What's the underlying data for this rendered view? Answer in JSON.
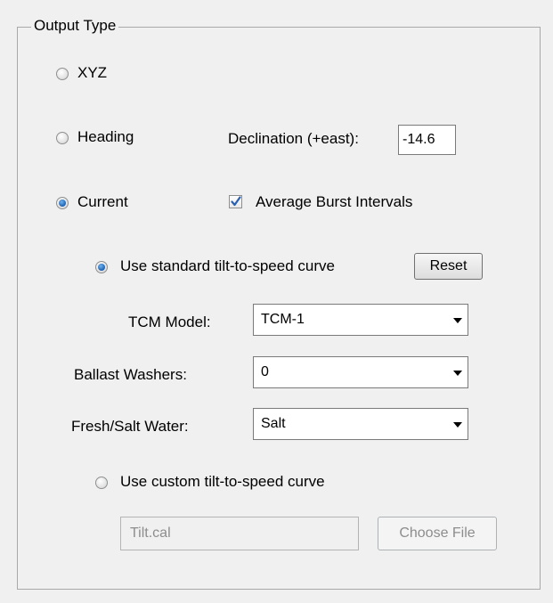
{
  "group": {
    "title": "Output Type"
  },
  "output": {
    "xyz": {
      "label": "XYZ",
      "selected": false
    },
    "heading": {
      "label": "Heading",
      "selected": false
    },
    "current": {
      "label": "Current",
      "selected": true
    }
  },
  "declination": {
    "label": "Declination (+east):",
    "value": "-14.6"
  },
  "average_burst": {
    "label": "Average Burst Intervals",
    "checked": true
  },
  "standard_curve": {
    "label": "Use standard tilt-to-speed curve",
    "selected": true,
    "reset_label": "Reset"
  },
  "tcm_model": {
    "label": "TCM Model:",
    "value": "TCM-1"
  },
  "ballast_washers": {
    "label": "Ballast Washers:",
    "value": "0"
  },
  "water": {
    "label": "Fresh/Salt Water:",
    "value": "Salt"
  },
  "custom_curve": {
    "label": "Use custom tilt-to-speed curve",
    "selected": false,
    "file_value": "Tilt.cal",
    "choose_label": "Choose File"
  },
  "colors": {
    "radio_selected": "#1c5fb0",
    "check_mark": "#2a5fb0"
  }
}
